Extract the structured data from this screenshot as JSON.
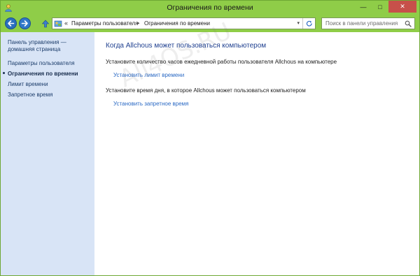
{
  "window": {
    "title": "Ограничения по времени",
    "caption": {
      "minimize": "—",
      "maximize": "□",
      "close": "✕"
    }
  },
  "navbar": {
    "address_chevron": "«",
    "breadcrumbs": [
      "Параметры пользователя",
      "Ограничения по времени"
    ],
    "breadcrumb_separator": "▸",
    "dropdown_arrow": "▾",
    "search_placeholder": "Поиск в панели управления"
  },
  "sidebar": {
    "home_link": "Панель управления — домашняя страница",
    "items": [
      {
        "label": "Параметры пользователя",
        "current": false
      },
      {
        "label": "Ограничения по времени",
        "current": true
      },
      {
        "label": "Лимит времени",
        "current": false
      },
      {
        "label": "Запретное время",
        "current": false
      }
    ]
  },
  "main": {
    "heading": "Когда Allchous может пользоваться компьютером",
    "section1_text": "Установите количество часов ежедневной работы пользователя Allchous на компьютере",
    "section1_link": "Установить лимит времени",
    "section2_text": "Установите время дня, в которое Allchous может пользоваться компьютером",
    "section2_link": "Установить запретное время"
  },
  "watermark": "All4OS.RU",
  "colors": {
    "accent": "#8fcd48",
    "sidebar_bg": "#d8e4f6",
    "link": "#2a69c4",
    "heading": "#1e3f8f",
    "close_button": "#c7504a"
  },
  "icons": [
    "app-icon",
    "back-arrow-icon",
    "forward-arrow-icon",
    "up-arrow-icon",
    "control-panel-icon",
    "refresh-icon",
    "search-icon"
  ]
}
